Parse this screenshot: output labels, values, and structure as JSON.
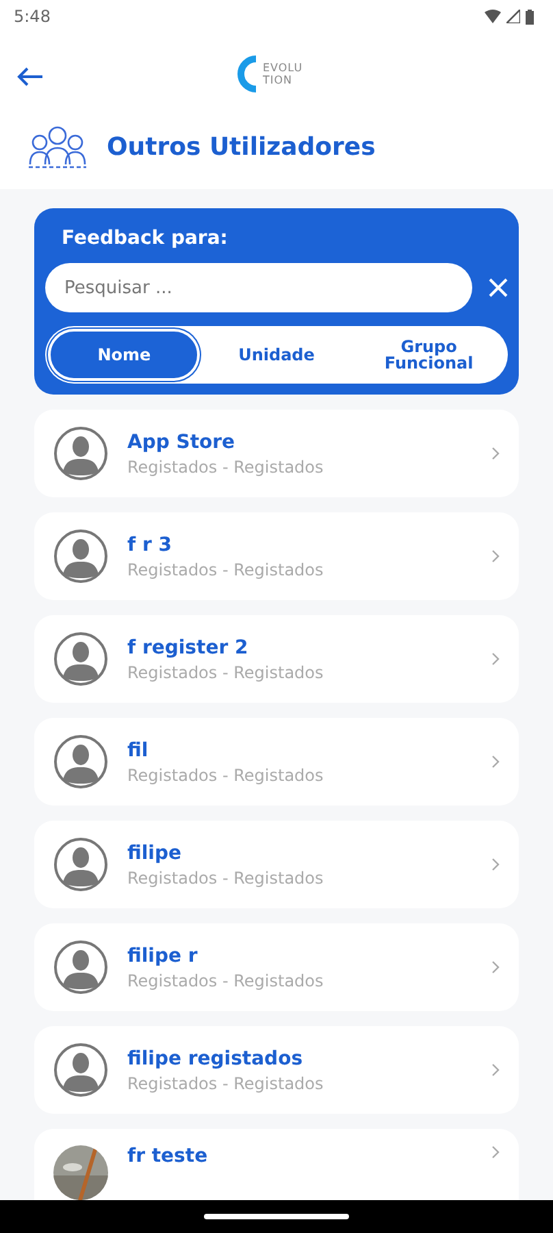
{
  "status_bar": {
    "time": "5:48"
  },
  "header": {
    "logo_lines": [
      "EVOLU",
      "TION"
    ],
    "title": "Outros Utilizadores"
  },
  "feedback": {
    "title": "Feedback para:",
    "search": {
      "placeholder": "Pesquisar ..."
    },
    "tabs": [
      {
        "label": "Nome",
        "selected": true
      },
      {
        "label": "Unidade",
        "selected": false
      },
      {
        "label": "Grupo Funcional",
        "selected": false
      }
    ]
  },
  "users": [
    {
      "name": "App Store",
      "subtitle": "Registados - Registados",
      "kind": "default"
    },
    {
      "name": "f r 3",
      "subtitle": "Registados - Registados",
      "kind": "default"
    },
    {
      "name": "f register 2",
      "subtitle": "Registados - Registados",
      "kind": "default"
    },
    {
      "name": "fil",
      "subtitle": "Registados - Registados",
      "kind": "default"
    },
    {
      "name": "filipe",
      "subtitle": "Registados - Registados",
      "kind": "default"
    },
    {
      "name": "filipe r",
      "subtitle": "Registados - Registados",
      "kind": "default"
    },
    {
      "name": "filipe registados",
      "subtitle": "Registados - Registados",
      "kind": "default"
    },
    {
      "name": "fr teste",
      "kind": "picture"
    }
  ]
}
